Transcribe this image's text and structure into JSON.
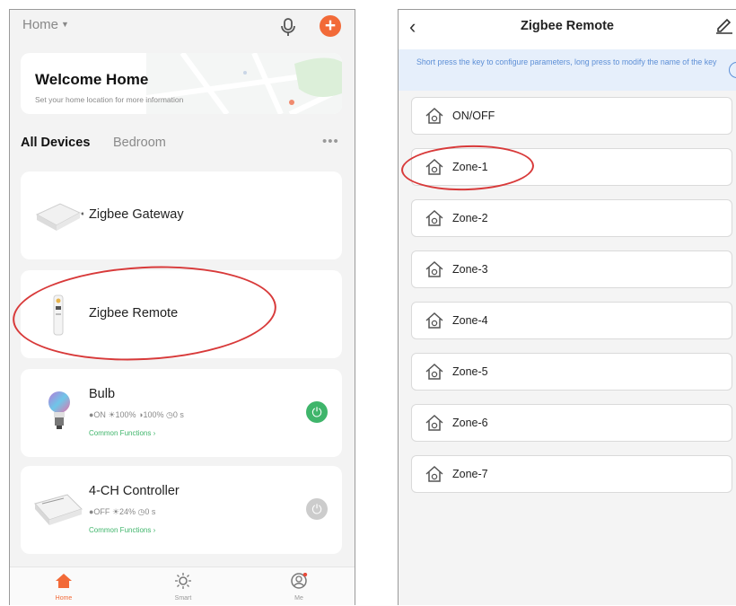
{
  "left": {
    "home_selector": "Home",
    "welcome": {
      "title": "Welcome Home",
      "subtitle": "Set your home location for more information"
    },
    "tabs": [
      "All Devices",
      "Bedroom"
    ],
    "more": "•••",
    "devices": [
      {
        "name": "Zigbee Gateway"
      },
      {
        "name": "Zigbee Remote"
      },
      {
        "name": "Bulb",
        "status": "●ON  ☀100%  ◑100%  ◷0 s",
        "functions": "Common Functions ›"
      },
      {
        "name": "4-CH Controller",
        "status": "●OFF  ☀24%  ◷0 s",
        "functions": "Common Functions ›"
      }
    ],
    "nav": [
      {
        "label": "Home"
      },
      {
        "label": "Smart"
      },
      {
        "label": "Me"
      }
    ],
    "colors": {
      "accent": "#f26a38",
      "power_on": "#3fb56b",
      "power_off": "#cccccc"
    }
  },
  "right": {
    "back": "‹",
    "title": "Zigbee Remote",
    "hint": "Short press the key to configure parameters, long press to modify the name of the key",
    "keys": [
      "ON/OFF",
      "Zone-1",
      "Zone-2",
      "Zone-3",
      "Zone-4",
      "Zone-5",
      "Zone-6",
      "Zone-7"
    ]
  },
  "annotation_color": "#d83a3a"
}
